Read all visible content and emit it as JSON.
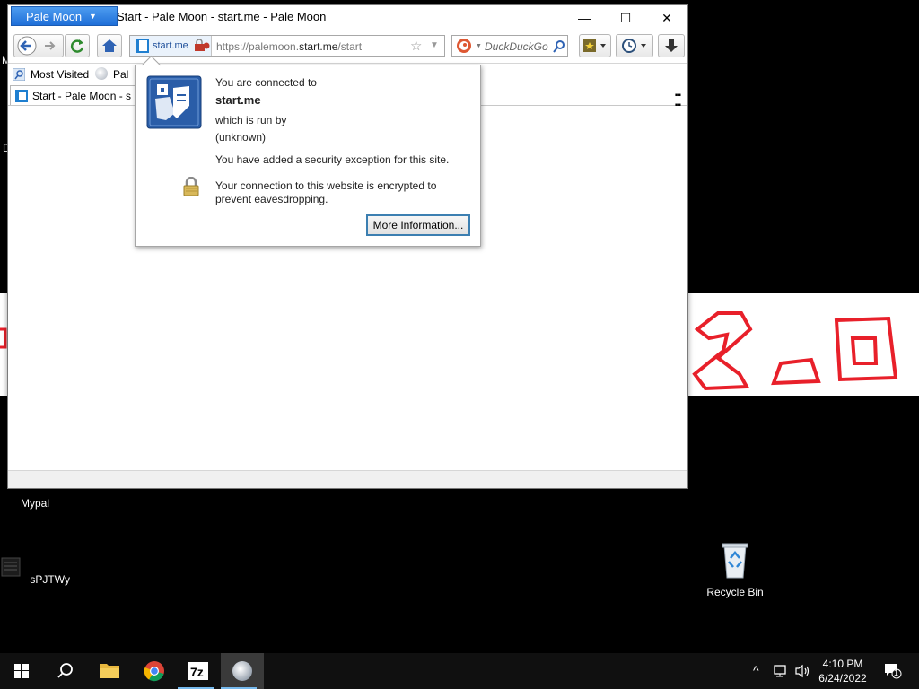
{
  "desktop": {
    "icons": [
      {
        "id": "mypal",
        "label": "Mypal"
      },
      {
        "id": "spjtwy",
        "label": "sPJTWy"
      },
      {
        "id": "recycle",
        "label": "Recycle Bin"
      }
    ],
    "partial_labels": [
      "M",
      "D"
    ]
  },
  "window": {
    "app_menu_label": "Pale Moon",
    "title": "Start - Pale Moon - start.me - Pale Moon",
    "controls": {
      "minimize": "—",
      "maximize": "☐",
      "close": "✕"
    }
  },
  "navbar": {
    "site_identity": "start.me",
    "url_prefix": "https://palemoon.",
    "url_host": "start.me",
    "url_path": "/start",
    "search_placeholder": "DuckDuckGo"
  },
  "bookmarks": {
    "items": [
      "Most Visited",
      "Pal"
    ]
  },
  "tabs": [
    {
      "label": "Start - Pale Moon - s"
    }
  ],
  "identity_popup": {
    "connected_to": "You are connected to",
    "site": "start.me",
    "run_by": "which is run by",
    "owner": "(unknown)",
    "exception": "You have added a security exception for this site.",
    "encrypted_line1": "Your connection to this website is encrypted to",
    "encrypted_line2": "prevent eavesdropping.",
    "more_info_button": "More Information..."
  },
  "taskbar": {
    "time": "4:10 PM",
    "date": "6/24/2022",
    "notification_count": "1"
  },
  "colors": {
    "accent": "#1f6fd8",
    "wallpaper_text": "#e8202a",
    "popup_button_border": "#3c7fb1"
  }
}
